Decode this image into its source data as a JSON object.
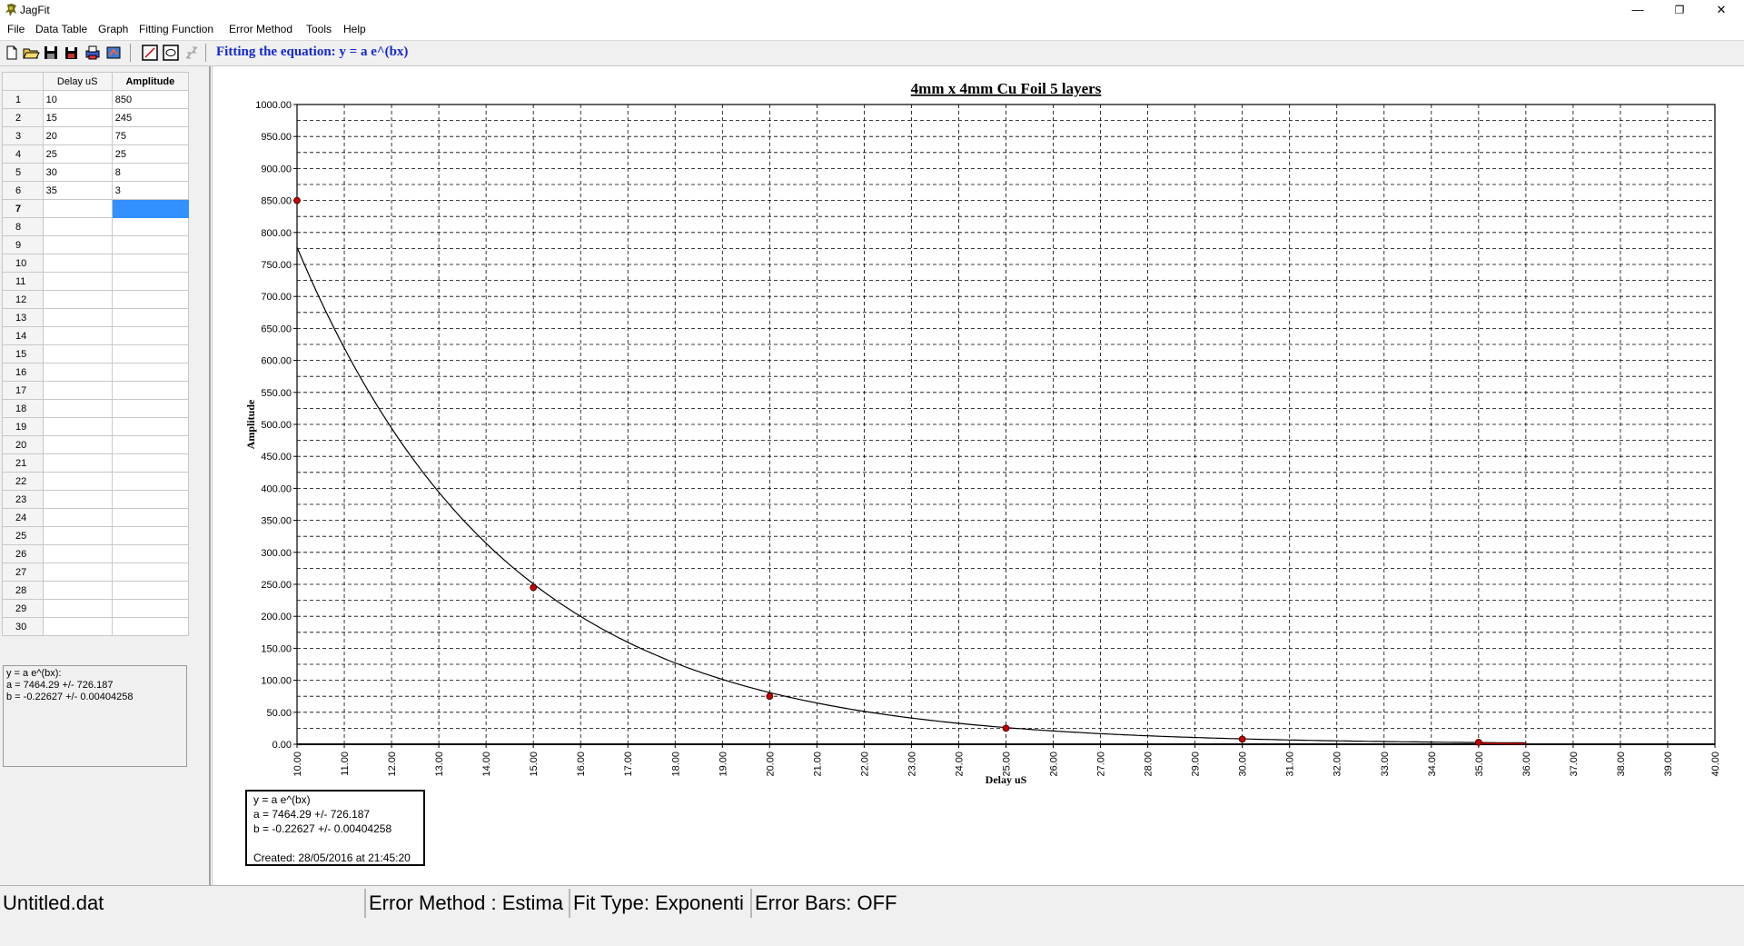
{
  "app": {
    "title": "JagFit"
  },
  "window": {
    "minimize": "—",
    "restore": "❐",
    "close": "✕"
  },
  "menu": [
    "File",
    "Data Table",
    "Graph",
    "Fitting Function",
    "Error Method",
    "Tools",
    "Help"
  ],
  "toolbar": {
    "buttons": [
      "new-file-icon",
      "open-folder-icon",
      "save-disk-icon",
      "save-all-icon",
      "print-icon",
      "export-icon",
      "graph-fit-icon",
      "graph-view-icon",
      "error-bars-icon"
    ],
    "equation_label": "Fitting the equation:  y = a e^(bx)"
  },
  "table": {
    "headers": [
      "Delay uS",
      "Amplitude"
    ],
    "rows": [
      [
        "1",
        "10",
        "850"
      ],
      [
        "2",
        "15",
        "245"
      ],
      [
        "3",
        "20",
        "75"
      ],
      [
        "4",
        "25",
        "25"
      ],
      [
        "5",
        "30",
        "8"
      ],
      [
        "6",
        "35",
        "3"
      ],
      [
        "7",
        "",
        ""
      ],
      [
        "8",
        "",
        ""
      ],
      [
        "9",
        "",
        ""
      ],
      [
        "10",
        "",
        ""
      ],
      [
        "11",
        "",
        ""
      ],
      [
        "12",
        "",
        ""
      ],
      [
        "13",
        "",
        ""
      ],
      [
        "14",
        "",
        ""
      ],
      [
        "15",
        "",
        ""
      ],
      [
        "16",
        "",
        ""
      ],
      [
        "17",
        "",
        ""
      ],
      [
        "18",
        "",
        ""
      ],
      [
        "19",
        "",
        ""
      ],
      [
        "20",
        "",
        ""
      ],
      [
        "21",
        "",
        ""
      ],
      [
        "22",
        "",
        ""
      ],
      [
        "23",
        "",
        ""
      ],
      [
        "24",
        "",
        ""
      ],
      [
        "25",
        "",
        ""
      ],
      [
        "26",
        "",
        ""
      ],
      [
        "27",
        "",
        ""
      ],
      [
        "28",
        "",
        ""
      ],
      [
        "29",
        "",
        ""
      ],
      [
        "30",
        "",
        ""
      ]
    ],
    "active_row": 7,
    "active_col": 2
  },
  "results": {
    "lines": [
      "y = a e^(bx):",
      "a = 7464.29  +/-  726.187",
      "b = -0.22627  +/-  0.00404258"
    ]
  },
  "legend": {
    "lines": [
      "y = a e^(bx)",
      "a = 7464.29 +/- 726.187",
      "b = -0.22627 +/- 0.00404258",
      "",
      "Created: 28/05/2016 at 21:45:20"
    ]
  },
  "statusbar": {
    "file": "Untitled.dat",
    "error_method": "Error Method : Estima",
    "fit_type": "Fit Type: Exponenti",
    "error_bars": "Error Bars: OFF"
  },
  "colors": {
    "equation": "#1428d2",
    "points": "#c00000",
    "selection": "#3390ff"
  },
  "chart_data": {
    "type": "scatter",
    "title": "4mm x 4mm Cu Foil 5 layers",
    "xlabel": "Delay uS",
    "ylabel": "Amplitude",
    "xlim": [
      10,
      40
    ],
    "ylim": [
      0,
      1000
    ],
    "grid": true,
    "points": {
      "x": [
        10,
        15,
        20,
        25,
        30,
        35
      ],
      "y": [
        850,
        245,
        75,
        25,
        8,
        3
      ]
    },
    "fit": {
      "a": 7464.29,
      "b": -0.22627,
      "x_range": [
        10,
        36
      ]
    }
  }
}
